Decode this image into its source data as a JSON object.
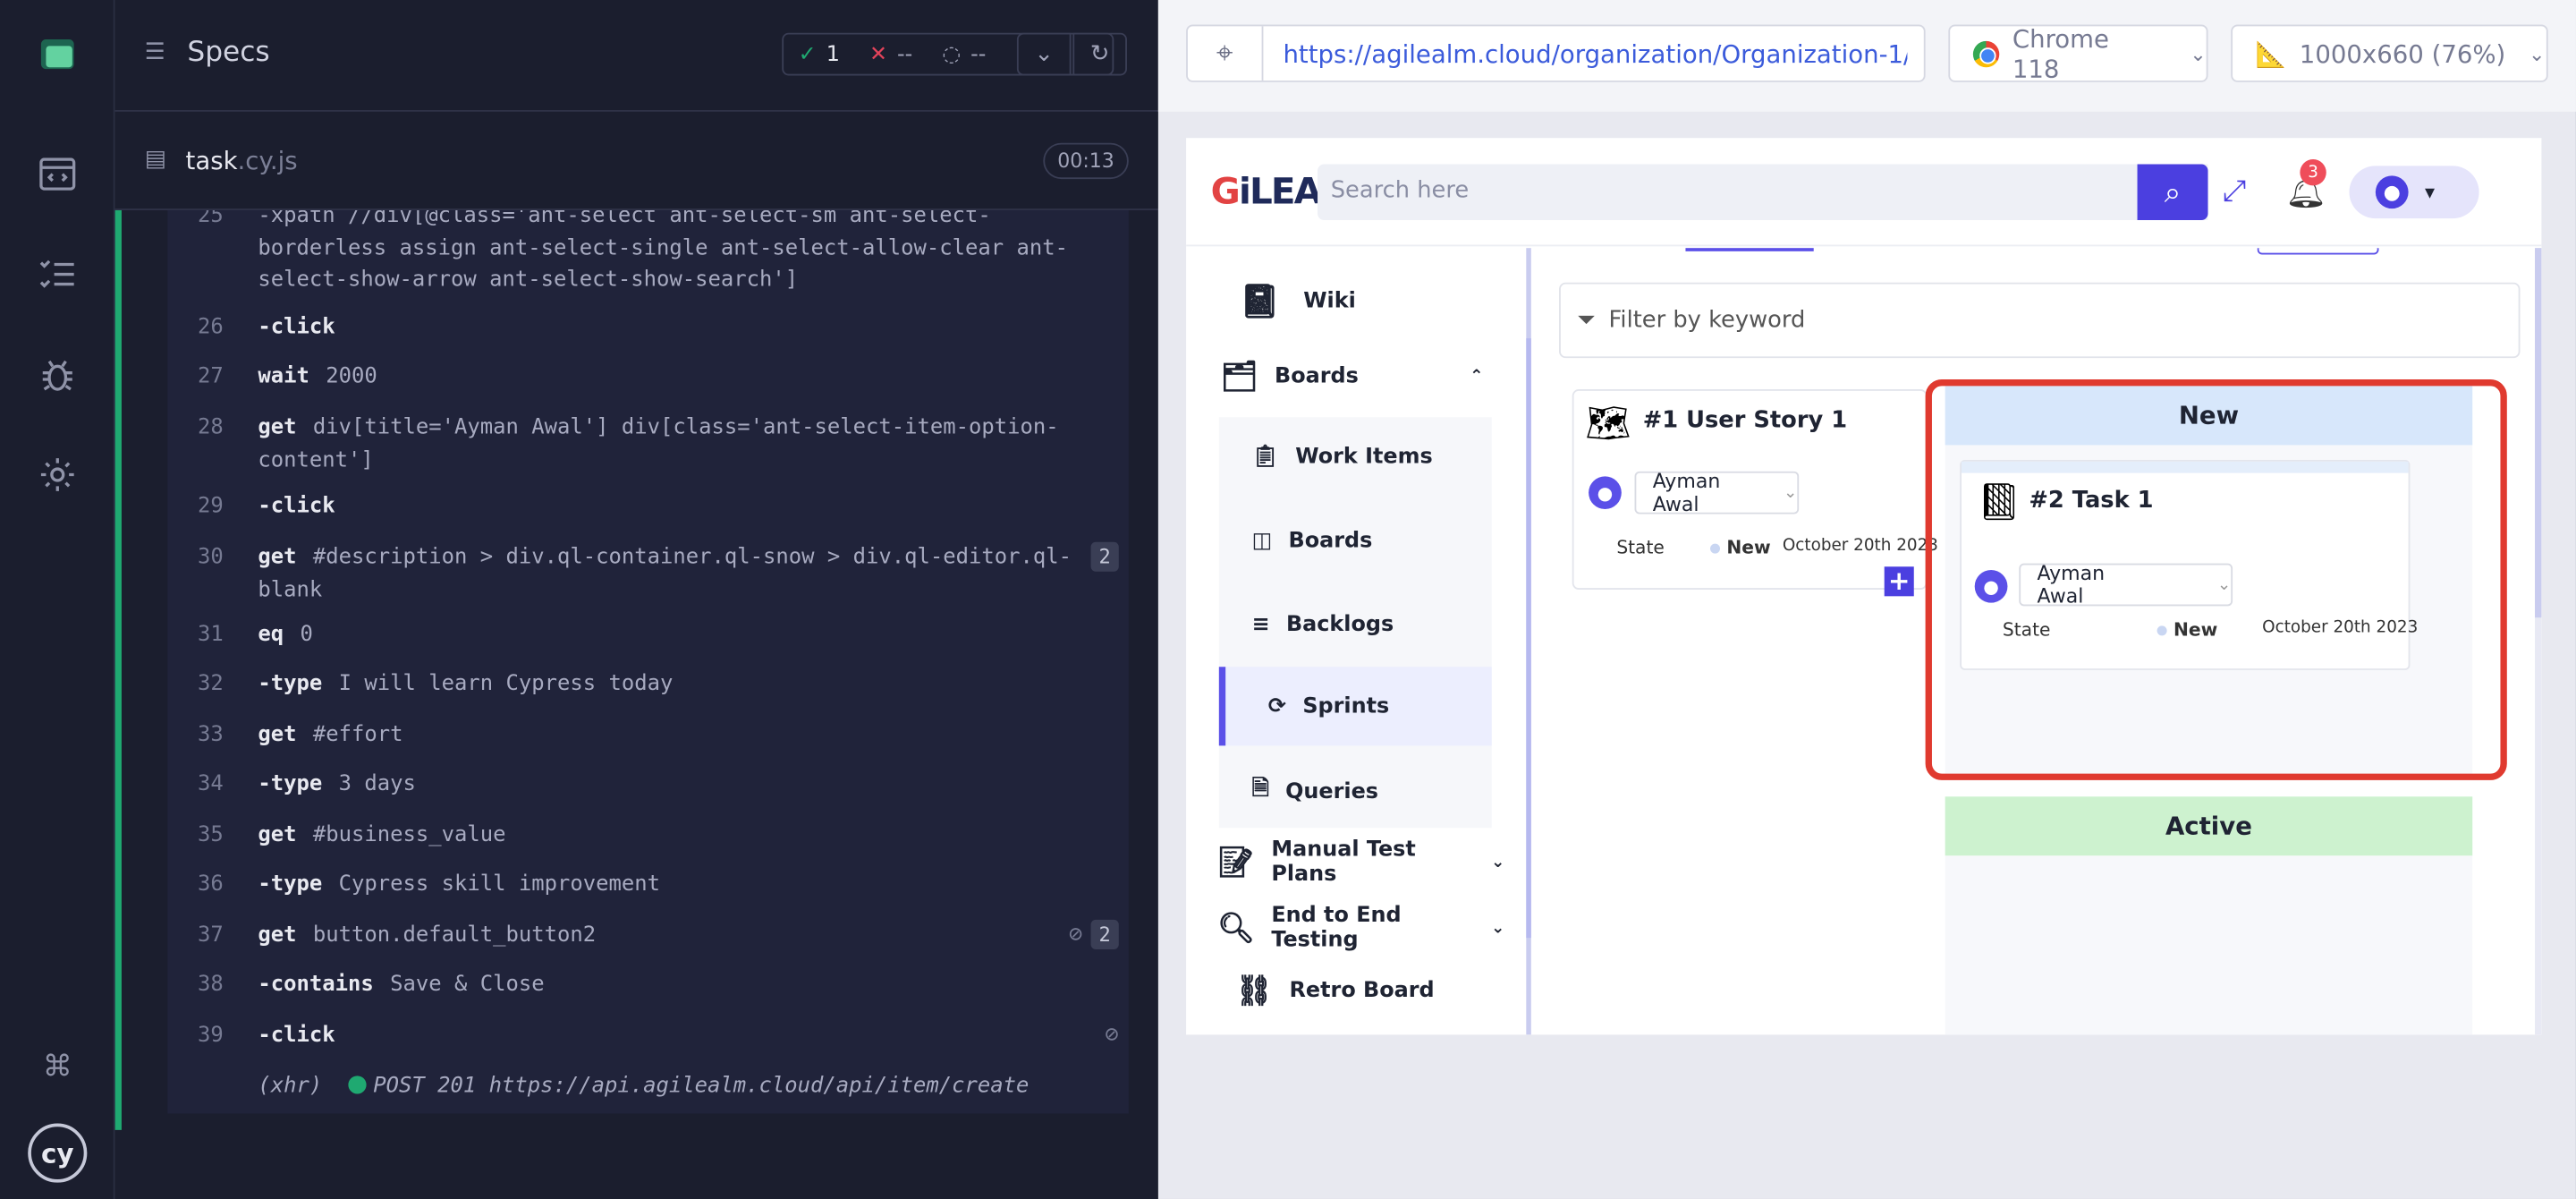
{
  "runner": {
    "specs_title": "Specs",
    "stats": {
      "passed": "1",
      "failed": "--",
      "pending": "--"
    },
    "file_name": "task",
    "file_ext": ".cy.js",
    "timer": "00:13"
  },
  "commands": [
    {
      "num": "25",
      "text": "-xpath //div[@class='ant-select ant-select-sm ant-select-borderless assign ant-select-single ant-select-allow-clear ant-select-show-arrow ant-select-show-search']"
    },
    {
      "num": "26",
      "name": "-click"
    },
    {
      "num": "27",
      "name": "wait",
      "arg": "2000"
    },
    {
      "num": "28",
      "name": "get",
      "arg": "div[title='Ayman Awal'] div[class='ant-select-item-option-content']"
    },
    {
      "num": "29",
      "name": "-click"
    },
    {
      "num": "30",
      "name": "get",
      "arg": "#description > div.ql-container.ql-snow > div.ql-editor.ql-blank",
      "badge": "2"
    },
    {
      "num": "31",
      "name": "eq",
      "arg": "0"
    },
    {
      "num": "32",
      "name": "-type",
      "arg": "I will learn Cypress today"
    },
    {
      "num": "33",
      "name": "get",
      "arg": "#effort"
    },
    {
      "num": "34",
      "name": "-type",
      "arg": "3 days"
    },
    {
      "num": "35",
      "name": "get",
      "arg": "#business_value"
    },
    {
      "num": "36",
      "name": "-type",
      "arg": "Cypress skill improvement"
    },
    {
      "num": "37",
      "name": "get",
      "arg": "button.default_button2",
      "badge": "2"
    },
    {
      "num": "38",
      "name": "-contains",
      "arg": "Save & Close"
    },
    {
      "num": "39",
      "name": "-click"
    }
  ],
  "xhr": {
    "label": "(xhr)",
    "text": "POST 201 https://api.agilealm.cloud/api/item/create"
  },
  "browser": {
    "url": "https://agilealm.cloud/organization/Organization-1/...",
    "browser_name": "Chrome 118",
    "viewport": "1000x660 (76%)"
  },
  "app": {
    "logo_g": "G",
    "logo_rest": "iLEA",
    "search_placeholder": "Search here",
    "notifications": "3",
    "sidebar": {
      "wiki": "Wiki",
      "boards": "Boards",
      "sub": [
        "Work Items",
        "Boards",
        "Backlogs",
        "Sprints",
        "Queries"
      ],
      "manual_test_plans": "Manual Test Plans",
      "e2e": "End to End Testing",
      "retro": "Retro Board"
    },
    "filter_placeholder": "Filter by keyword",
    "user_story": {
      "title": "#1 User Story 1",
      "owner": "Ayman Awal",
      "state_label": "State",
      "state": "New",
      "date": "October 20th 2023"
    },
    "column_new": "New",
    "task": {
      "title": "#2 Task 1",
      "owner": "Ayman Awal",
      "state_label": "State",
      "state": "New",
      "date": "October 20th 2023"
    },
    "column_active": "Active"
  }
}
